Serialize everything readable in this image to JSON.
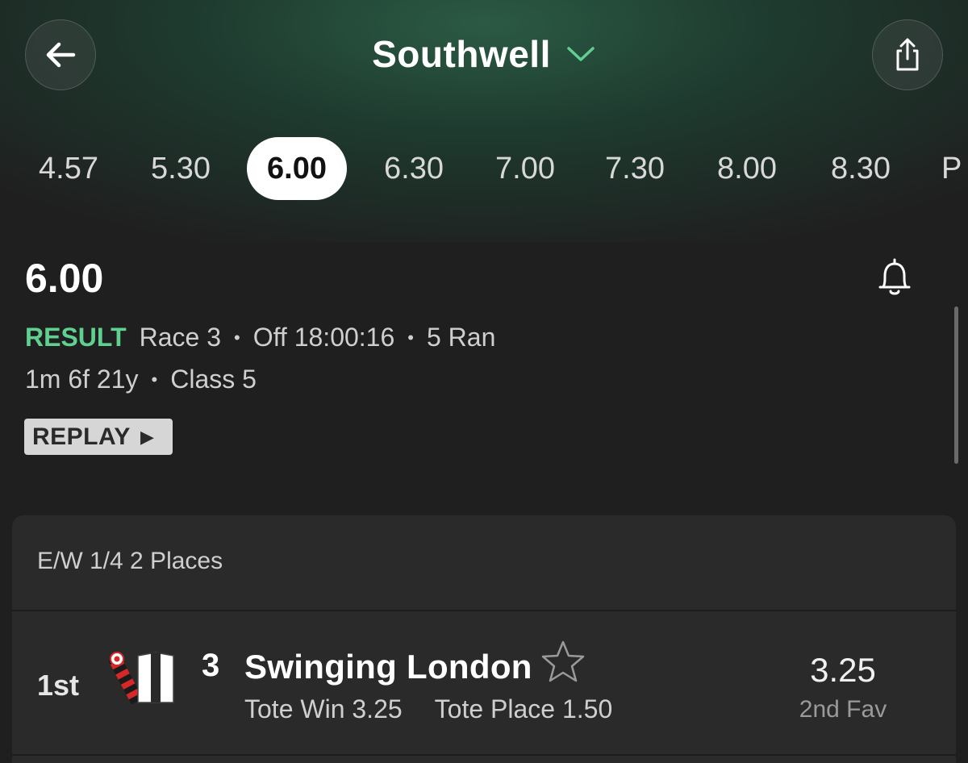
{
  "header": {
    "title": "Southwell",
    "back_icon": "arrow-left-icon",
    "share_icon": "share-icon",
    "dropdown_icon": "chevron-down-icon",
    "accent_color": "#5fd08f"
  },
  "race_times": [
    "4.57",
    "5.30",
    "6.00",
    "6.30",
    "7.00",
    "7.30",
    "8.00",
    "8.30",
    "P"
  ],
  "selected_time": "6.00",
  "race": {
    "title": "6.00",
    "status": "RESULT",
    "race_number": "Race 3",
    "off_time": "Off 18:00:16",
    "runners": "5 Ran",
    "distance": "1m 6f 21y",
    "class": "Class 5",
    "replay_label": "REPLAY",
    "bell_icon": "bell-icon"
  },
  "results": {
    "terms": "E/W 1/4 2 Places",
    "rows": [
      {
        "position": "1st",
        "number": "3",
        "name": "Swinging London",
        "tote_win": "Tote Win 3.25",
        "tote_place": "Tote Place 1.50",
        "odds": "3.25",
        "fav_label": "2nd Fav"
      }
    ]
  }
}
